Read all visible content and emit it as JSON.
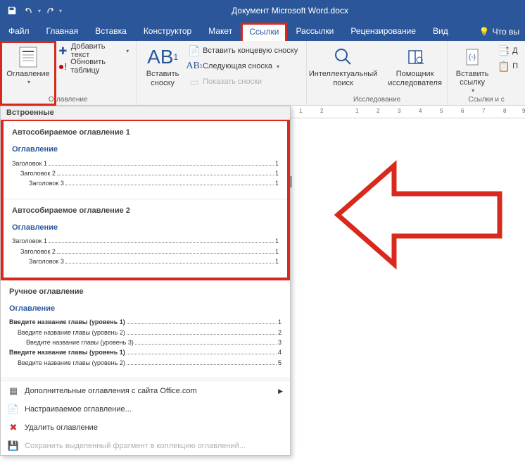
{
  "titlebar": {
    "title": "Документ Microsoft Word.docx"
  },
  "tabs": {
    "file": "Файл",
    "items": [
      "Главная",
      "Вставка",
      "Конструктор",
      "Макет",
      "Ссылки",
      "Рассылки",
      "Рецензирование",
      "Вид"
    ],
    "active_index": 4,
    "help": "Что вы"
  },
  "ribbon": {
    "toc": {
      "label": "Оглавление"
    },
    "addText": "Добавить текст",
    "updateTable": "Обновить таблицу",
    "groupTocLabel": "Оглавление",
    "insertFootnote": "Вставить сноску",
    "ab": "AB",
    "insertEndnote": "Вставить концевую сноску",
    "nextFootnote": "Следующая сноска",
    "showFootnotes": "Показать сноски",
    "smartLookup": "Интеллектуальный поиск",
    "researcher": "Помощник исследователя",
    "researchGroup": "Исследование",
    "insertLink": "Вставить ссылку",
    "linksGroup": "Ссылки и с",
    "extra1": "Д",
    "extra2": "П"
  },
  "panel": {
    "builtIn": "Встроенные",
    "auto1": {
      "title": "Автособираемое оглавление 1",
      "heading": "Оглавление",
      "lines": [
        {
          "lvl": 1,
          "txt": "Заголовок 1",
          "pg": "1"
        },
        {
          "lvl": 2,
          "txt": "Заголовок 2",
          "pg": "1"
        },
        {
          "lvl": 3,
          "txt": "Заголовок 3",
          "pg": "1"
        }
      ]
    },
    "auto2": {
      "title": "Автособираемое оглавление 2",
      "heading": "Оглавление",
      "lines": [
        {
          "lvl": 1,
          "txt": "Заголовок 1",
          "pg": "1"
        },
        {
          "lvl": 2,
          "txt": "Заголовок 2",
          "pg": "1"
        },
        {
          "lvl": 3,
          "txt": "Заголовок 3",
          "pg": "1"
        }
      ]
    },
    "manual": {
      "title": "Ручное оглавление",
      "heading": "Оглавление",
      "lines": [
        {
          "lvl": 1,
          "bold": true,
          "txt": "Введите название главы (уровень 1)",
          "pg": "1"
        },
        {
          "lvl": 2,
          "bold": false,
          "txt": "Введите название главы (уровень 2)",
          "pg": "2"
        },
        {
          "lvl": 3,
          "bold": false,
          "txt": "Введите название главы (уровень 3)",
          "pg": "3"
        },
        {
          "lvl": 1,
          "bold": true,
          "txt": "Введите название главы (уровень 1)",
          "pg": "4"
        },
        {
          "lvl": 2,
          "bold": false,
          "txt": "Введите название главы (уровень 2)",
          "pg": "5"
        }
      ]
    },
    "moreOffice": "Дополнительные оглавления с сайта Office.com",
    "custom": "Настраиваемое оглавление...",
    "remove": "Удалить оглавление",
    "save": "Сохранить выделенный фрагмент в коллекцию оглавлений..."
  },
  "ruler": {
    "nums": [
      "1",
      "2",
      "1",
      "2",
      "3",
      "4",
      "5",
      "6",
      "7",
      "8",
      "9"
    ]
  }
}
